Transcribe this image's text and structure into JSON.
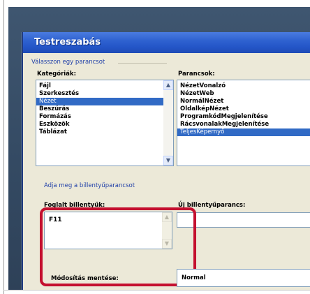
{
  "dialog": {
    "title": "Testreszabás",
    "select_group_label": "Válasszon egy parancsot",
    "categories_label": "Kategóriák:",
    "commands_label": "Parancsok:",
    "categories": [
      {
        "label": "Fájl",
        "selected": false
      },
      {
        "label": "Szerkesztés",
        "selected": false
      },
      {
        "label": "Nézet",
        "selected": true
      },
      {
        "label": "Beszúrás",
        "selected": false
      },
      {
        "label": "Formázás",
        "selected": false
      },
      {
        "label": "Eszközök",
        "selected": false
      },
      {
        "label": "Táblázat",
        "selected": false
      }
    ],
    "commands": [
      {
        "label": "NézetVonalzó",
        "selected": false
      },
      {
        "label": "NézetWeb",
        "selected": false
      },
      {
        "label": "NormálNézet",
        "selected": false
      },
      {
        "label": "OldalképNézet",
        "selected": false
      },
      {
        "label": "ProgramkódMegjelenítése",
        "selected": false
      },
      {
        "label": "RácsvonalakMegjelenítése",
        "selected": false
      },
      {
        "label": "TeljesKépernyő",
        "selected": true
      }
    ],
    "shortcut_group_label": "Adja meg a billentyűparancsot",
    "current_keys_label": "Foglalt billentyűk:",
    "current_keys_value": "F11",
    "new_key_label": "Új billentyűparancs:",
    "new_key_value": "",
    "save_changes_label": "Módosítás mentése:",
    "save_changes_value": "Normal"
  },
  "colors": {
    "backdrop": "#344a63",
    "dialog_bg": "#ece9d8",
    "titlebar": "#2456c8",
    "selection": "#316ac5",
    "highlight": "#c4102f"
  },
  "icons": [
    "scroll-up-icon",
    "scroll-down-icon"
  ]
}
